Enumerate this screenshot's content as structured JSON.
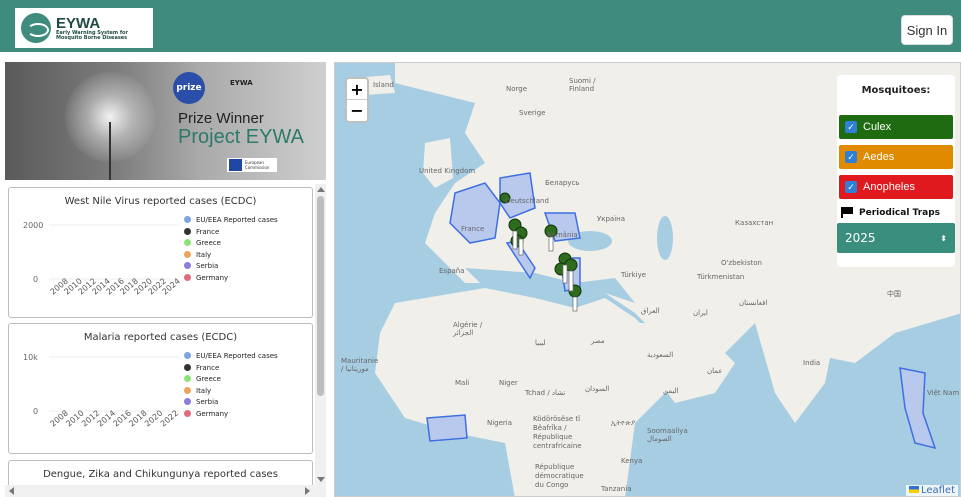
{
  "header": {
    "logo_title": "EYWA",
    "logo_subtitle": "Early Warning System for Mosquito Borne Diseases",
    "signin_label": "Sign In"
  },
  "banner": {
    "prize_badge": "prize",
    "line1": "Prize Winner",
    "line2": "Project EYWA",
    "logo_text": "EYWA",
    "eu_text": "European Commission"
  },
  "charts": [
    {
      "title": "West Nile Virus reported cases (ECDC)",
      "y_ticks": [
        "2000",
        "0"
      ],
      "x_ticks": [
        "2008",
        "2010",
        "2012",
        "2014",
        "2016",
        "2018",
        "2020",
        "2022",
        "2024"
      ],
      "legend": [
        {
          "label": "EU/EEA Reported cases",
          "color": "#7aa6e0"
        },
        {
          "label": "France",
          "color": "#333333"
        },
        {
          "label": "Greece",
          "color": "#8ee07a"
        },
        {
          "label": "Italy",
          "color": "#f0a35a"
        },
        {
          "label": "Serbia",
          "color": "#8a7ee0"
        },
        {
          "label": "Germany",
          "color": "#e06b7a"
        }
      ]
    },
    {
      "title": "Malaria reported cases (ECDC)",
      "y_ticks": [
        "10k",
        "0"
      ],
      "x_ticks": [
        "2008",
        "2010",
        "2012",
        "2014",
        "2016",
        "2018",
        "2020",
        "2022"
      ],
      "legend": [
        {
          "label": "EU/EEA Reported cases",
          "color": "#7aa6e0"
        },
        {
          "label": "France",
          "color": "#333333"
        },
        {
          "label": "Greece",
          "color": "#8ee07a"
        },
        {
          "label": "Italy",
          "color": "#f0a35a"
        },
        {
          "label": "Serbia",
          "color": "#8a7ee0"
        },
        {
          "label": "Germany",
          "color": "#e06b7a"
        }
      ]
    },
    {
      "title": "Dengue, Zika and Chikungunya reported cases"
    }
  ],
  "map": {
    "zoom_in": "+",
    "zoom_out": "−",
    "labels": [
      "Island",
      "Norge",
      "Suomi / Finland",
      "Sverige",
      "United Kingdom",
      "Беларусь",
      "Deutschland",
      "France",
      "Україна",
      "Казахстан",
      "România",
      "España",
      "Türkiye",
      "O'zbekiston",
      "Türkmenistan",
      "Algérie / الجزائر",
      "ليبيا",
      "مصر",
      "السعودية",
      "ایران",
      "افغانستان",
      "India",
      "中国",
      "Mauritanie / موريتانيا",
      "Mali",
      "Niger",
      "Tchad / تشاد",
      "السودان",
      "اليمن",
      "عمان",
      "Nigeria",
      "Ködörösêse tî Bêafrîka / République centrafricaine",
      "ኢትዮጵያ",
      "Soomaaliya الصومال",
      "Kenya",
      "République démocratique du Congo",
      "Tanzania",
      "Việt Nam",
      "العراق"
    ],
    "attribution": "Leaflet"
  },
  "mosquito_panel": {
    "title": "Mosquitoes:",
    "items": [
      {
        "label": "Culex",
        "color": "#1e6b12"
      },
      {
        "label": "Aedes",
        "color": "#e08a00"
      },
      {
        "label": "Anopheles",
        "color": "#e0191e"
      }
    ],
    "traps_label": "Periodical Traps",
    "year": "2025"
  }
}
